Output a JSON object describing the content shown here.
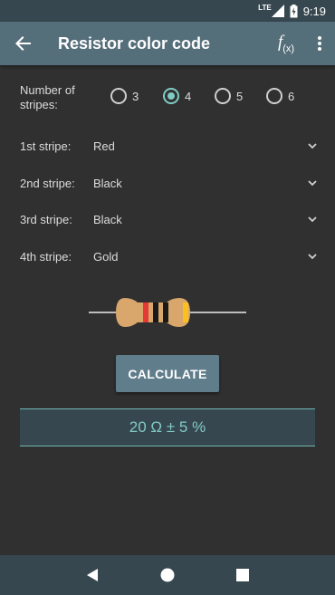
{
  "status_bar": {
    "network": "LTE",
    "time": "9:19"
  },
  "app_bar": {
    "title": "Resistor color code",
    "fx_label": "f",
    "fx_sub": "(x)"
  },
  "stripes": {
    "label": "Number of stripes:",
    "options": [
      "3",
      "4",
      "5",
      "6"
    ],
    "selected": "4"
  },
  "selects": [
    {
      "label": "1st stripe:",
      "value": "Red"
    },
    {
      "label": "2nd stripe:",
      "value": "Black"
    },
    {
      "label": "3rd stripe:",
      "value": "Black"
    },
    {
      "label": "4th stripe:",
      "value": "Gold"
    }
  ],
  "resistor": {
    "band_colors": [
      "#e53935",
      "#1a1a1a",
      "#1a1a1a",
      "#f9c020"
    ],
    "body_color": "#d9a66b",
    "lead_color": "#bdbdbd"
  },
  "calculate_label": "CALCULATE",
  "result": "20 Ω ± 5 %",
  "colors": {
    "background": "#303030",
    "app_bar": "#546e7a",
    "status_bar": "#37474f",
    "accent": "#80cbc4",
    "button": "#607d8b"
  }
}
